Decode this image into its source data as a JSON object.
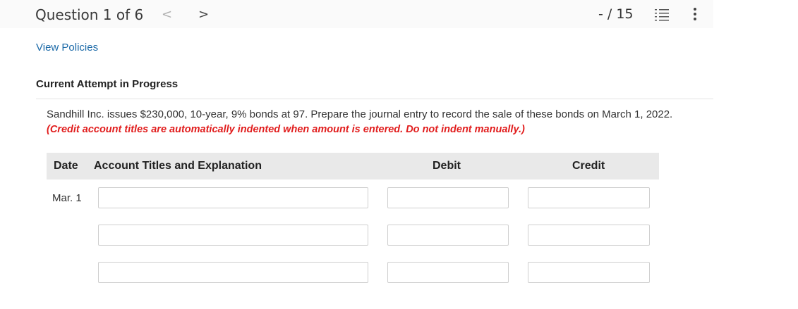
{
  "header": {
    "question_label": "Question 1 of 6",
    "prev_glyph": "<",
    "next_glyph": ">",
    "score": "- / 15"
  },
  "links": {
    "view_policies": "View Policies"
  },
  "attempt_label": "Current Attempt in Progress",
  "question": {
    "text": "Sandhill Inc. issues $230,000, 10-year, 9% bonds at 97. Prepare the journal entry to record the sale of these bonds on March 1, 2022.",
    "instruction": "(Credit account titles are automatically indented when amount is entered. Do not indent manually.)"
  },
  "table": {
    "headers": {
      "date": "Date",
      "account": "Account Titles and Explanation",
      "debit": "Debit",
      "credit": "Credit"
    },
    "date_value": "Mar. 1",
    "rows": [
      {
        "account": "",
        "debit": "",
        "credit": ""
      },
      {
        "account": "",
        "debit": "",
        "credit": ""
      },
      {
        "account": "",
        "debit": "",
        "credit": ""
      }
    ]
  },
  "colors": {
    "accent_link": "#1c6aa8",
    "instruction_red": "#e11d1d",
    "header_bg": "#e9e9e9"
  },
  "icons": [
    "chevron-left-icon",
    "chevron-right-icon",
    "list-icon",
    "more-vertical-icon"
  ]
}
